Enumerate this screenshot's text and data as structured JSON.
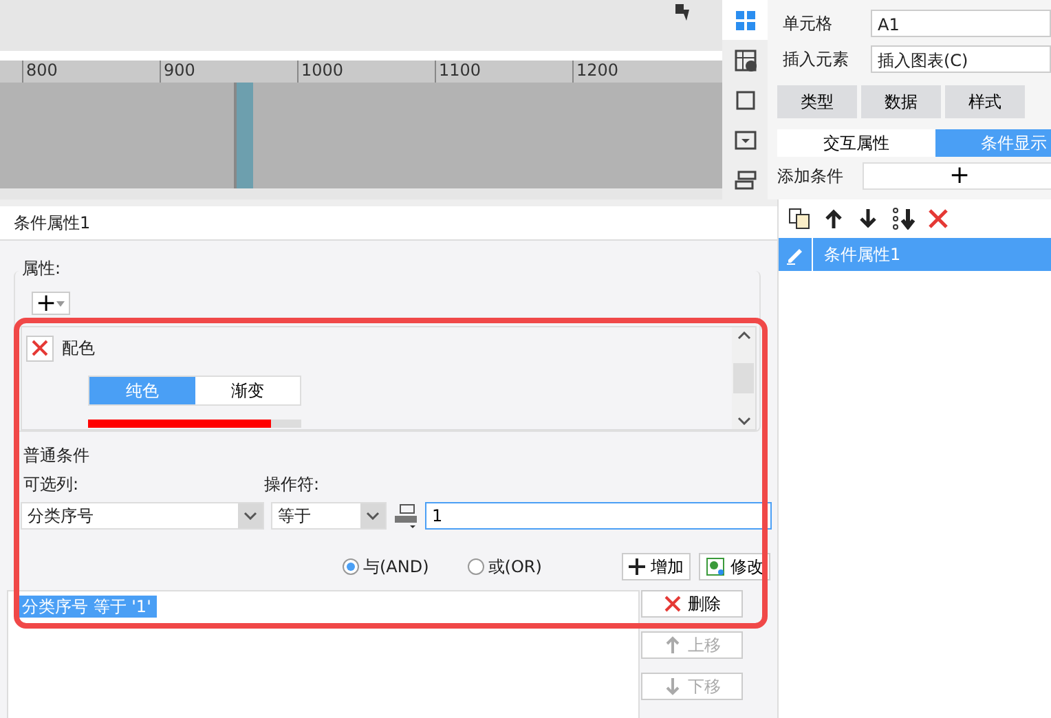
{
  "ruler": {
    "labels": [
      "800",
      "900",
      "1000",
      "1100",
      "1200"
    ]
  },
  "side_icons": [
    {
      "kind": "grid",
      "selected": true
    },
    {
      "kind": "table",
      "selected": false
    },
    {
      "kind": "frame",
      "selected": false
    },
    {
      "kind": "dropdown",
      "selected": false
    },
    {
      "kind": "stack",
      "selected": false
    }
  ],
  "cell_props": {
    "cell_label": "单元格",
    "cell_value": "A1",
    "insert_label": "插入元素",
    "insert_value": "插入图表(C)"
  },
  "tabs": [
    {
      "label": "类型",
      "selected": false
    },
    {
      "label": "数据",
      "selected": false
    },
    {
      "label": "样式",
      "selected": false
    }
  ],
  "subtabs": [
    {
      "label": "交互属性",
      "selected": false
    },
    {
      "label": "条件显示",
      "selected": true
    }
  ],
  "add_condition": {
    "label": "添加条件",
    "button": "+"
  },
  "dialog": {
    "title": "条件属性1",
    "attributes_label": "属性:",
    "add_symbol": "+",
    "attribute": {
      "name": "配色",
      "tabs": [
        {
          "label": "纯色",
          "selected": true
        },
        {
          "label": "渐变",
          "selected": false
        }
      ],
      "color": "#ff0000",
      "level": 0.86
    },
    "condition": {
      "group_label": "普通条件",
      "column_label": "可选列:",
      "operator_label": "操作符:",
      "column_value": "分类序号",
      "operator_value": "等于",
      "value": "1",
      "logic": [
        {
          "label": "与(AND)",
          "selected": true
        },
        {
          "label": "或(OR)",
          "selected": false
        }
      ],
      "add_button": "增加",
      "modify_button": "修改",
      "items": [
        {
          "text": "分类序号 等于 '1'",
          "selected": true
        }
      ],
      "side_buttons": [
        {
          "kind": "delete",
          "label": "删除",
          "disabled": false
        },
        {
          "kind": "up",
          "label": "上移",
          "disabled": true
        },
        {
          "kind": "down",
          "label": "下移",
          "disabled": true
        }
      ]
    }
  },
  "conditions_list": {
    "items": [
      {
        "label": "条件属性1",
        "selected": true
      }
    ]
  }
}
